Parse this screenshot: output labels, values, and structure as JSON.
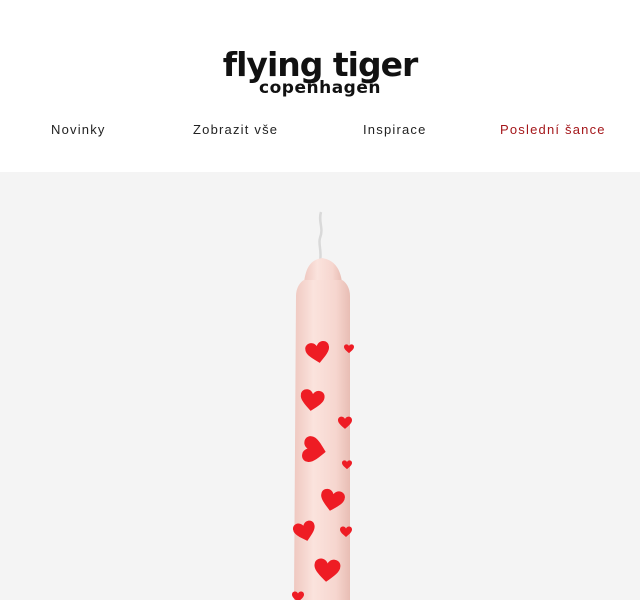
{
  "brand": {
    "name": "flying tiger",
    "subtitle": "copenhagen"
  },
  "nav": {
    "items": [
      {
        "label": "Novinky"
      },
      {
        "label": "Zobrazit vše"
      },
      {
        "label": "Inspirace"
      },
      {
        "label": "Poslední šance"
      }
    ]
  },
  "colors": {
    "accent_sale": "#a4161a",
    "hero_bg": "#f4f4f4",
    "candle": "#f7d8d2",
    "heart": "#ee1c24"
  },
  "hero": {
    "image": "candle-with-red-hearts"
  }
}
